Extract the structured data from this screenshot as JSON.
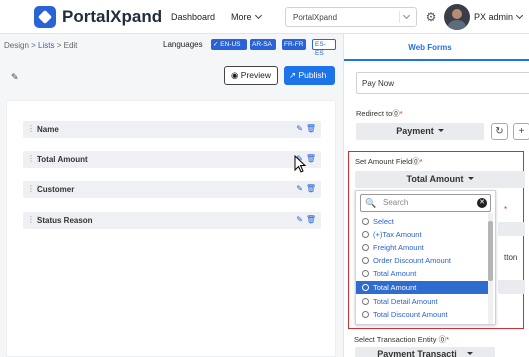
{
  "header": {
    "logo_text": "PortalXpand",
    "nav": {
      "dashboard": "Dashboard",
      "more": "More"
    },
    "app_select": "PortalXpand",
    "user": "PX admin"
  },
  "breadcrumb": {
    "design": "Design",
    "lists": "Lists",
    "edit": "Edit"
  },
  "languages": {
    "label": "Languages",
    "items": [
      "✓ EN-US",
      "AR-SA",
      "FR-FR",
      "ES-ES"
    ]
  },
  "toolbar": {
    "preview": "Preview",
    "publish": "Publish"
  },
  "fields": [
    "Name",
    "Total Amount",
    "Customer",
    "Status Reason"
  ],
  "panel": {
    "tab": "Web Forms",
    "button_text_value": "Pay Now",
    "redirect_label": "Redirect to",
    "redirect_value": "Payment",
    "amount_label": "Set Amount Field",
    "amount_value": "Total Amount",
    "transaction_label": "Select Transaction Entity",
    "transaction_value": "Payment Transacti",
    "partial_right_1": "*",
    "partial_right_2": "tton"
  },
  "dropdown": {
    "search_placeholder": "Search",
    "options": [
      "Select",
      "(+)Tax Amount",
      "Freight Amount",
      "Order Discount Amount",
      "Total Amount",
      "Total Amount",
      "Total Detail Amount",
      "Total Discount Amount"
    ],
    "selected_index": 5
  },
  "colors": {
    "accent": "#1e73e8",
    "highlight": "#d32f2f"
  }
}
